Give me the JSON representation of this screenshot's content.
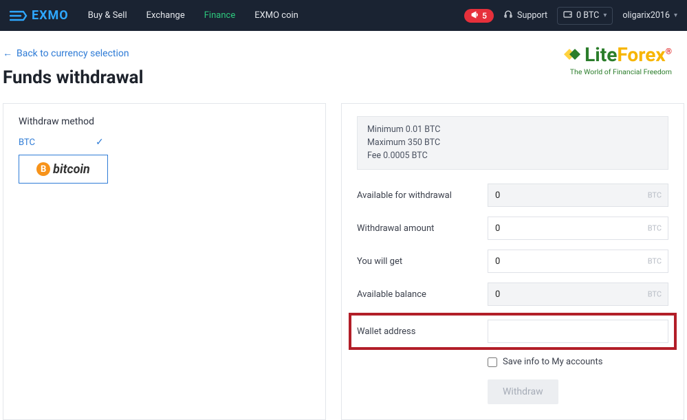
{
  "header": {
    "brand": "EXMO",
    "nav": {
      "buy_sell": "Buy & Sell",
      "exchange": "Exchange",
      "finance": "Finance",
      "exmo_coin": "EXMO coin"
    },
    "alerts_count": "5",
    "support": "Support",
    "wallet_balance": "0 BTC",
    "username": "oligarix2016"
  },
  "overlay_logo": {
    "part1": "Lite",
    "part2": "Forex",
    "tagline": "The World of Financial Freedom"
  },
  "back_link": "Back to currency selection",
  "page_title": "Funds withdrawal",
  "left": {
    "section_title": "Withdraw method",
    "tab_label": "BTC",
    "method_symbol": "B",
    "method_name": "bitcoin"
  },
  "right": {
    "limits": {
      "min": "Minimum 0.01 BTC",
      "max": "Maximum 350 BTC",
      "fee": "Fee 0.0005 BTC"
    },
    "rows": {
      "available": {
        "label": "Available for withdrawal",
        "value": "0",
        "unit": "BTC"
      },
      "amount": {
        "label": "Withdrawal amount",
        "value": "0",
        "unit": "BTC"
      },
      "youget": {
        "label": "You will get",
        "value": "0",
        "unit": "BTC"
      },
      "balance": {
        "label": "Available balance",
        "value": "0",
        "unit": "BTC"
      },
      "wallet": {
        "label": "Wallet address",
        "value": ""
      }
    },
    "save_label": "Save info to My accounts",
    "submit_label": "Withdraw"
  }
}
